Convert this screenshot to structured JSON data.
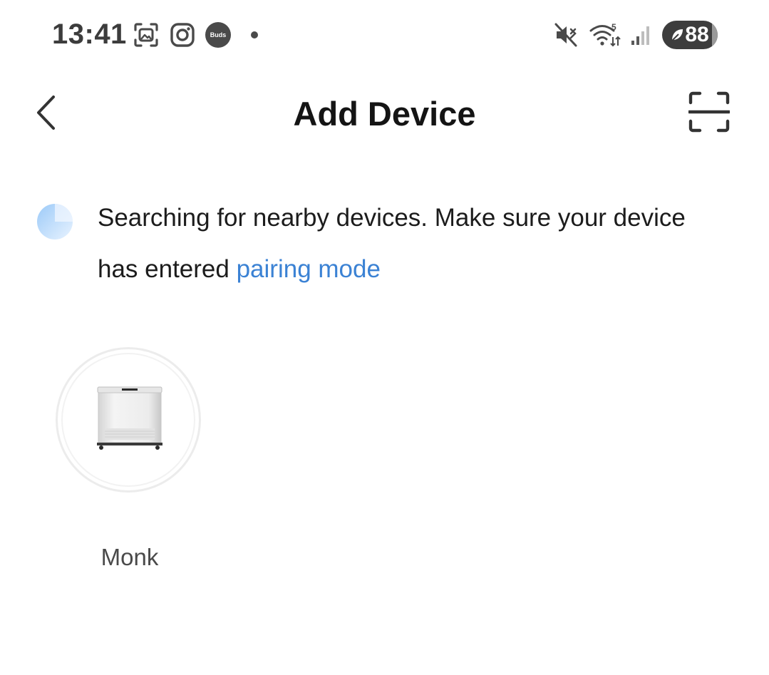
{
  "status_bar": {
    "time": "13:41",
    "notification_icons": [
      "screenshot-icon",
      "instagram-icon",
      "buds-icon",
      "more-notifications-dot"
    ],
    "buds_label": "Buds",
    "wifi_badge": "5",
    "battery_level": "88",
    "icons_right": [
      "mute-icon",
      "wifi-icon",
      "signal-icon",
      "battery-saver-icon"
    ]
  },
  "header": {
    "title": "Add Device",
    "back_icon": "chevron-left-icon",
    "scan_icon": "scan-qr-icon"
  },
  "search_status": {
    "message": "Searching for nearby devices. Make sure your device has entered ",
    "link_label": "pairing mode",
    "link_color": "#3b82d4",
    "spinner_color": "#a9d2fb"
  },
  "devices": [
    {
      "name": "Monk",
      "icon": "air-purifier-device-image"
    }
  ]
}
